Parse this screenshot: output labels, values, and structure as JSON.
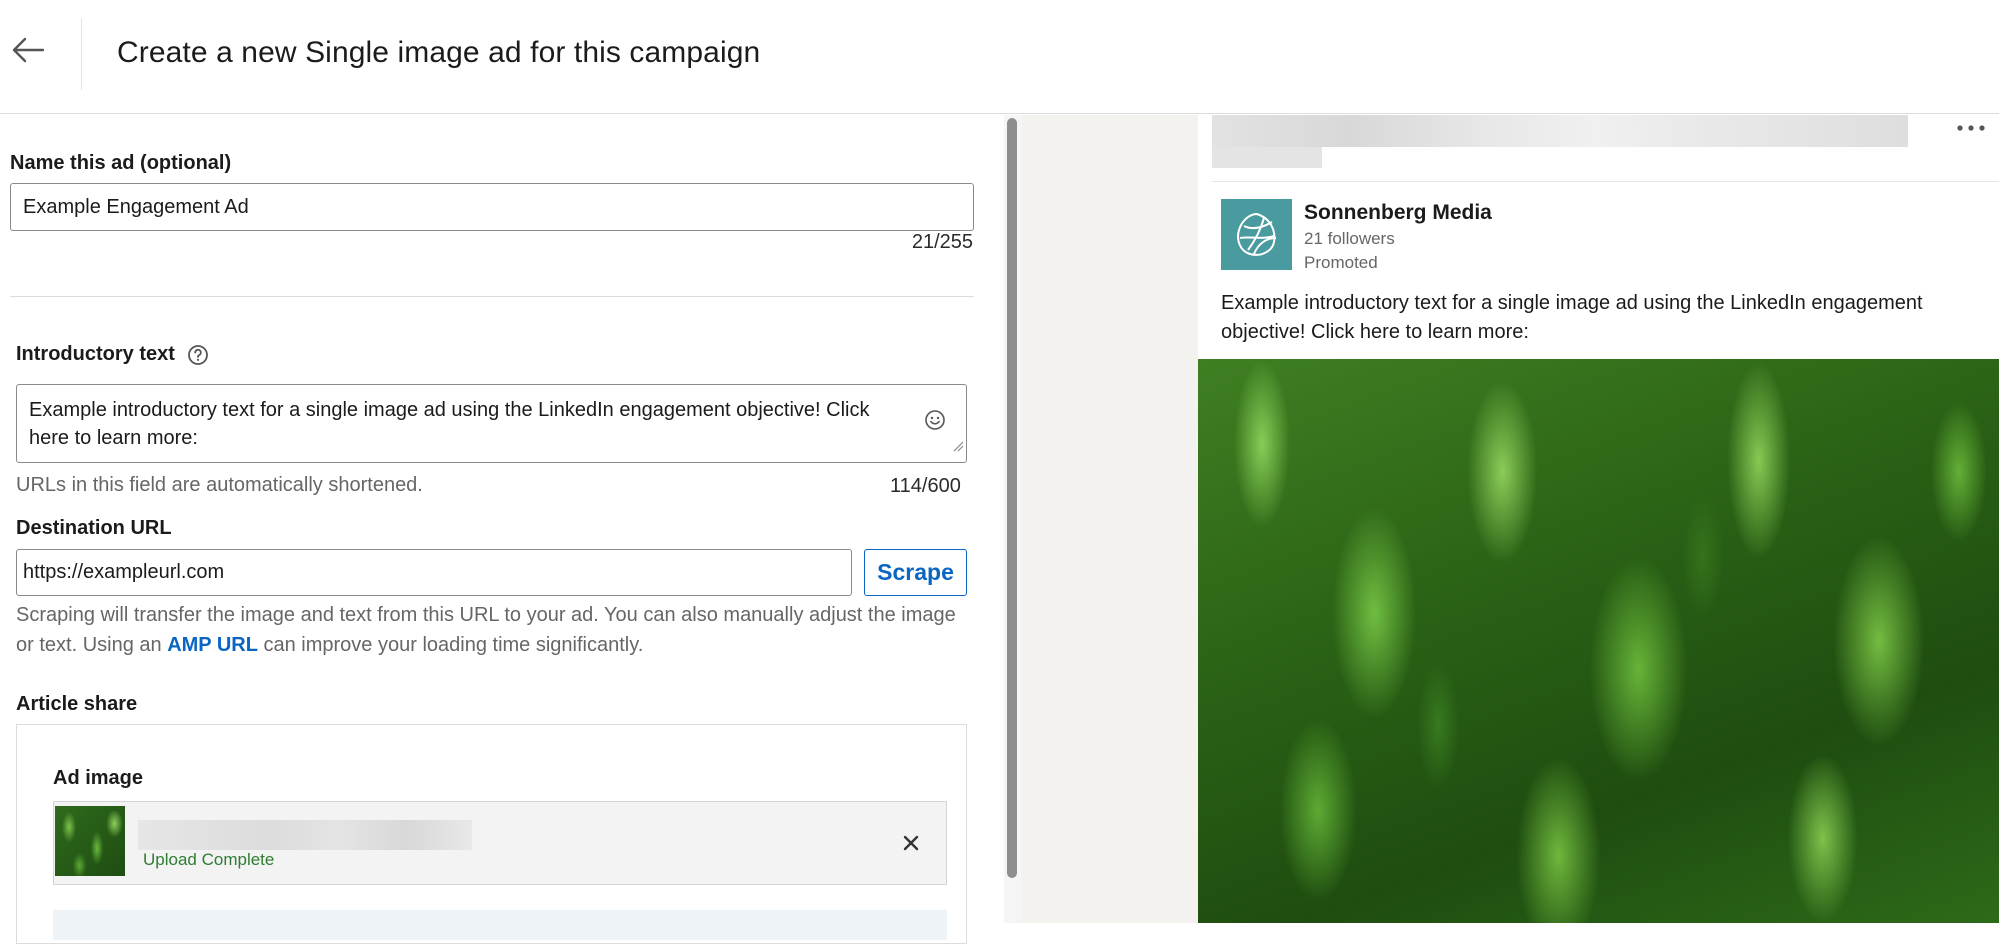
{
  "header": {
    "title": "Create a new Single image ad for this campaign"
  },
  "form": {
    "ad_name": {
      "label": "Name this ad (optional)",
      "value": "Example Engagement Ad",
      "counter": "21/255"
    },
    "intro_text": {
      "label": "Introductory text",
      "value": "Example introductory text for a single image ad using the LinkedIn engagement objective! Click here to learn more:",
      "line1": "Example introductory text for a single image ad using the LinkedIn engagement objective! Click",
      "line2": "here to learn more:",
      "hint": "URLs in this field are automatically shortened.",
      "counter": "114/600"
    },
    "destination_url": {
      "label": "Destination URL",
      "value": "https://exampleurl.com",
      "scrape_label": "Scrape",
      "hint_part1": "Scraping will transfer the image and text from this URL to your ad. You can also manually adjust the image or text. Using an ",
      "hint_link": "AMP URL",
      "hint_part2": " can improve your loading time significantly."
    },
    "article_share": {
      "label": "Article share",
      "ad_image_label": "Ad image",
      "upload_status": "Upload Complete"
    }
  },
  "preview": {
    "company_name": "Sonnenberg Media",
    "followers": "21 followers",
    "promoted": "Promoted",
    "intro_line1": "Example introductory text for a single image ad using the LinkedIn engagement",
    "intro_line2": "objective! Click here to learn more:"
  },
  "colors": {
    "accent": "#0a66c2",
    "upload_success": "#2e7d32",
    "logo_bg": "#4a9ba0"
  }
}
